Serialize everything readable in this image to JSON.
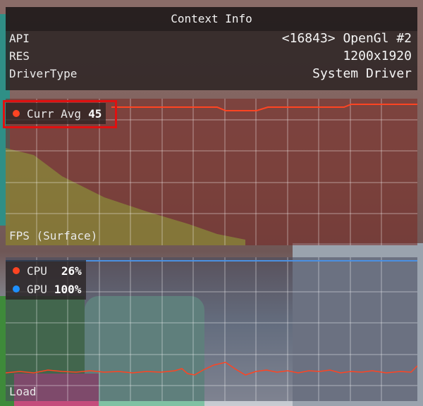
{
  "context_info": {
    "title": "Context Info",
    "rows": [
      {
        "key": "API",
        "value": "<16843> OpenGl #2"
      },
      {
        "key": "RES",
        "value": "1200x1920"
      },
      {
        "key": "DriverType",
        "value": "System Driver"
      }
    ]
  },
  "fps_graph": {
    "label": "FPS (Surface)",
    "legend": {
      "name": "Curr Avg",
      "value": "45",
      "color": "#ff4422"
    }
  },
  "load_graph": {
    "label": "Load",
    "legend": [
      {
        "name": "CPU",
        "value": "26%",
        "color": "#ff4422"
      },
      {
        "name": "GPU",
        "value": "100%",
        "color": "#1e90ff"
      }
    ]
  },
  "colors": {
    "cpu_line": "#ff4422",
    "gpu_line": "#4a90e2",
    "fps_line": "#ff4422",
    "highlight": "#e01010"
  }
}
